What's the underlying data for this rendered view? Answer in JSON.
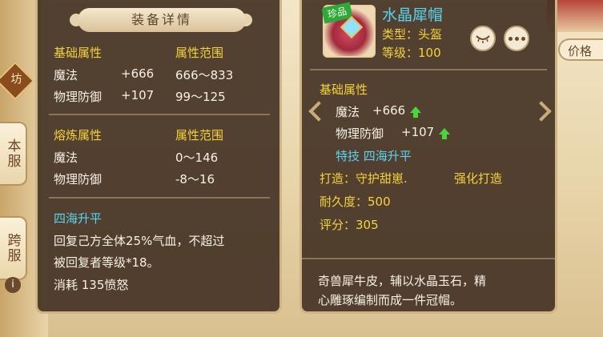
{
  "left_panel": {
    "title": "装备详情",
    "base_header": "基础属性",
    "range_header": "属性范围",
    "base_stats": [
      {
        "name": "魔法",
        "value": "+666",
        "range": "666～833"
      },
      {
        "name": "物理防御",
        "value": "+107",
        "range": "99～125"
      }
    ],
    "refine_header": "熔炼属性",
    "refine_range_header": "属性范围",
    "refine_stats": [
      {
        "name": "魔法",
        "range": "0～146"
      },
      {
        "name": "物理防御",
        "range": "-8～16"
      }
    ],
    "skill_name": "四海升平",
    "skill_desc_line1": "回复己方全体25%气血，不超过",
    "skill_desc_line2": "被回复者等级*18。",
    "skill_cost": "消耗  135愤怒"
  },
  "right_panel": {
    "rare_badge": "珍品",
    "item_name": "水晶犀帽",
    "type_text": "类型：头盔",
    "level_text": "等级：100",
    "base_header": "基础属性",
    "stats": [
      {
        "name": "魔法",
        "value": "+666"
      },
      {
        "name": "物理防御",
        "value": "+107"
      }
    ],
    "special_skill": "特技  四海升平",
    "forge_text": "打造：守护甜崽.",
    "enhance_text": "强化打造",
    "durability_text": "耐久度：500",
    "score_text": "评分：305",
    "desc_line1": "奇兽犀牛皮，辅以水晶玉石，精",
    "desc_line2": "心雕琢编制而成一件冠帽。"
  },
  "side": {
    "badge": "坊",
    "tab_server": "本服",
    "tab_cross": "跨服",
    "info": "i"
  },
  "top_right": {
    "price_label": "价格"
  },
  "colors": {
    "panel_bg": "#463426",
    "label_yellow": "#f4d23c",
    "value_white": "#f6f1e6",
    "accent_cyan": "#59d4f0",
    "up_green": "#4bd43c"
  },
  "icons": [
    "eye-closed-icon",
    "more-icon",
    "arrow-up-icon",
    "chevron-left-icon",
    "chevron-right-icon",
    "info-icon"
  ]
}
